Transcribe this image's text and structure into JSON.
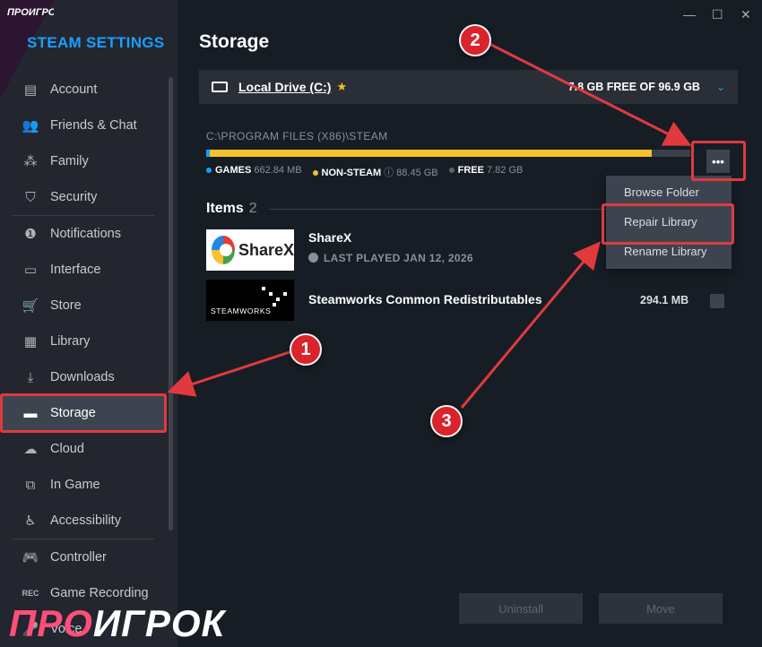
{
  "sidebar": {
    "title": "STEAM SETTINGS",
    "items": [
      {
        "label": "Account",
        "icon": "account-card-icon"
      },
      {
        "label": "Friends & Chat",
        "icon": "friends-icon"
      },
      {
        "label": "Family",
        "icon": "family-icon"
      },
      {
        "label": "Security",
        "icon": "shield-icon"
      },
      {
        "label": "Notifications",
        "icon": "info-icon"
      },
      {
        "label": "Interface",
        "icon": "monitor-icon"
      },
      {
        "label": "Store",
        "icon": "cart-icon"
      },
      {
        "label": "Library",
        "icon": "grid-icon"
      },
      {
        "label": "Downloads",
        "icon": "download-icon"
      },
      {
        "label": "Storage",
        "icon": "drive-icon",
        "active": true
      },
      {
        "label": "Cloud",
        "icon": "cloud-icon"
      },
      {
        "label": "In Game",
        "icon": "in-game-icon"
      },
      {
        "label": "Accessibility",
        "icon": "accessibility-icon"
      },
      {
        "label": "Controller",
        "icon": "controller-icon"
      },
      {
        "label": "Game Recording",
        "icon": "rec-icon"
      },
      {
        "label": "Voice",
        "icon": "mic-icon"
      }
    ],
    "corner_logo": "ПРОИГРОК"
  },
  "window": {
    "minimize": "—",
    "maximize": "☐",
    "close": "✕"
  },
  "main": {
    "title": "Storage",
    "drive": {
      "name": "Local Drive (C:)",
      "free": "7.8 GB FREE OF 96.9 GB"
    },
    "path": "C:\\PROGRAM FILES (X86)\\STEAM",
    "usage": {
      "games_fraction": 0.007,
      "nonsteam_fraction": 0.913,
      "free_fraction": 0.08
    },
    "legend": [
      {
        "label": "GAMES",
        "value": "662.84 MB",
        "color": "#1a9fff"
      },
      {
        "label": "NON-STEAM",
        "value": "88.45 GB",
        "color": "#f2c230"
      },
      {
        "label": "FREE",
        "value": "7.82 GB",
        "color": "#5d636c"
      }
    ],
    "more_button": "•••",
    "menu": [
      "Browse Folder",
      "Repair Library",
      "Rename Library"
    ],
    "items_label": "Items",
    "items_count": "2",
    "games": [
      {
        "name": "ShareX",
        "last_played": "LAST PLAYED JAN 12, 2026",
        "thumb_text": "ShareX"
      },
      {
        "name": "Steamworks Common Redistributables",
        "size": "294.1 MB",
        "thumb_text": "STEAMWORKS"
      }
    ],
    "buttons": {
      "uninstall": "Uninstall",
      "move": "Move"
    }
  },
  "annotations": {
    "badge1": "1",
    "badge2": "2",
    "badge3": "3",
    "color": "#e03a3e"
  },
  "watermark": {
    "pro": "ПРО",
    "rest": "ИГРОК"
  }
}
